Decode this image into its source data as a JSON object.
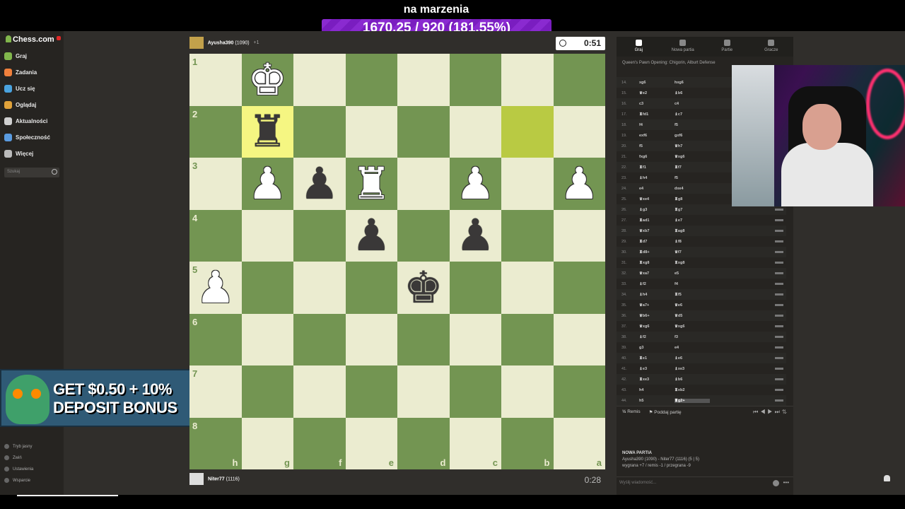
{
  "stream": {
    "title": "na marzenia",
    "goal": "1670.25 / 920 (181.55%)"
  },
  "sidebar": {
    "logo": "Chess.com",
    "items": [
      {
        "label": "Graj",
        "icon": "play-icon",
        "color": "#81b64c"
      },
      {
        "label": "Zadania",
        "icon": "puzzle-icon",
        "color": "#f0803c"
      },
      {
        "label": "Ucz się",
        "icon": "learn-icon",
        "color": "#4aa3df"
      },
      {
        "label": "Oglądaj",
        "icon": "watch-icon",
        "color": "#e0a23a"
      },
      {
        "label": "Aktualności",
        "icon": "news-icon",
        "color": "#d0d0d0"
      },
      {
        "label": "Społeczność",
        "icon": "community-icon",
        "color": "#5a9be0"
      },
      {
        "label": "Więcej",
        "icon": "more-icon",
        "color": "#bbbbbb"
      }
    ],
    "search_placeholder": "Szukaj",
    "bottom": [
      {
        "label": "Tryb jasny",
        "icon": "theme-icon"
      },
      {
        "label": "Zwiń",
        "icon": "collapse-icon"
      },
      {
        "label": "Ustawienia",
        "icon": "settings-icon"
      },
      {
        "label": "Wsparcie",
        "icon": "support-icon"
      }
    ]
  },
  "ad": {
    "line1": "GET $0.50 + 10%",
    "line2": "DEPOSIT BONUS"
  },
  "players": {
    "top": {
      "name": "Ayusha390",
      "rating": "(1090)",
      "extra": "+1",
      "clock": "0:51"
    },
    "bottom": {
      "name": "Niter77",
      "rating": "(1116)",
      "clock": "0:28"
    }
  },
  "board": {
    "ranks": [
      "1",
      "2",
      "3",
      "4",
      "5",
      "6",
      "7",
      "8"
    ],
    "files": [
      "h",
      "g",
      "f",
      "e",
      "d",
      "c",
      "b",
      "a"
    ],
    "highlight_from": "b2",
    "highlight_to": "g2",
    "pieces": {
      "g1": "♚w",
      "g2": "♜b",
      "g3": "♟w",
      "f3": "♟b",
      "e3": "♜w",
      "c3": "♟w",
      "a3": "♟w",
      "e4": "♟b",
      "c4": "♟b",
      "h5": "♟w",
      "d5": "♚b"
    }
  },
  "panel": {
    "tabs": [
      {
        "label": "Graj",
        "icon": "lightning-icon"
      },
      {
        "label": "Nowa partia",
        "icon": "plus-icon"
      },
      {
        "label": "Partie",
        "icon": "games-icon"
      },
      {
        "label": "Gracze",
        "icon": "players-icon"
      }
    ],
    "opening": "Queen's Pawn Opening: Chigorin, Alburt Defense",
    "moves": [
      {
        "n": "14.",
        "w": "xg6",
        "b": "hxg6"
      },
      {
        "n": "15.",
        "w": "♛e2",
        "b": "♝b6"
      },
      {
        "n": "16.",
        "w": "c3",
        "b": "c4"
      },
      {
        "n": "17.",
        "w": "♜fd1",
        "b": "♝c7"
      },
      {
        "n": "18.",
        "w": "f4",
        "b": "f5"
      },
      {
        "n": "19.",
        "w": "exf6",
        "b": "gxf6"
      },
      {
        "n": "20.",
        "w": "f5",
        "b": "♛h7"
      },
      {
        "n": "21.",
        "w": "fxg6",
        "b": "♛xg6"
      },
      {
        "n": "22.",
        "w": "♜f1",
        "b": "♜f7"
      },
      {
        "n": "23.",
        "w": "♝h4",
        "b": "f5"
      },
      {
        "n": "24.",
        "w": "e4",
        "b": "dxe4"
      },
      {
        "n": "25.",
        "w": "♛xe4",
        "b": "♜g8"
      },
      {
        "n": "26.",
        "w": "♝g3",
        "b": "♜g7"
      },
      {
        "n": "27.",
        "w": "♜ad1",
        "b": "♝e7"
      },
      {
        "n": "28.",
        "w": "♛xb7",
        "b": "♜ag8"
      },
      {
        "n": "29.",
        "w": "♜d7",
        "b": "♝f8"
      },
      {
        "n": "30.",
        "w": "♜d8+",
        "b": "♛f7"
      },
      {
        "n": "31.",
        "w": "♜xg8",
        "b": "♜xg8"
      },
      {
        "n": "32.",
        "w": "♛xa7",
        "b": "e5"
      },
      {
        "n": "33.",
        "w": "♝f2",
        "b": "f4"
      },
      {
        "n": "34.",
        "w": "♝h4",
        "b": "♜f5"
      },
      {
        "n": "35.",
        "w": "♛a7+",
        "b": "♛e6"
      },
      {
        "n": "36.",
        "w": "♛b6+",
        "b": "♛d5"
      },
      {
        "n": "37.",
        "w": "♛xg6",
        "b": "♛xg6"
      },
      {
        "n": "38.",
        "w": "♝f2",
        "b": "f3"
      },
      {
        "n": "39.",
        "w": "g3",
        "b": "e4"
      },
      {
        "n": "40.",
        "w": "♜e1",
        "b": "♝e6"
      },
      {
        "n": "41.",
        "w": "♝e3",
        "b": "♝xe3"
      },
      {
        "n": "42.",
        "w": "♜xe3",
        "b": "♝b6"
      },
      {
        "n": "43.",
        "w": "h4",
        "b": "♜xb2"
      },
      {
        "n": "44.",
        "w": "h5",
        "b": "♜g2+"
      }
    ],
    "draw_label": "Remis",
    "resign_label": "Poddaj partię",
    "game_title": "NOWA PARTIA",
    "game_players": "Ayusha390 (1090) - Niter77 (1116) (5 | 5)",
    "game_record": "wygrana +7 / remis -1 / przegrana -9",
    "message_placeholder": "Wyślij wiadomość..."
  }
}
